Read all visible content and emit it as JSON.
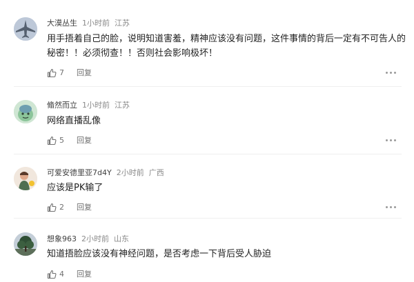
{
  "comments": [
    {
      "user": "大漠丛生",
      "time": "1小时前",
      "location": "江苏",
      "text": "用手捂着自己的脸，说明知道害羞，精神应该没有问题，这件事情的背后一定有不可告人的秘密！！必须彻查！！否则社会影响极坏！",
      "likes": "7",
      "reply_label": "回复",
      "avatar_icon": "fighter-jet-icon"
    },
    {
      "user": "翛然而立",
      "time": "1小时前",
      "location": "江苏",
      "text": "网络直播乱像",
      "likes": "5",
      "reply_label": "回复",
      "avatar_icon": "cartoon-creature-icon"
    },
    {
      "user": "可爱安德里亚7d4Y",
      "time": "2小时前",
      "location": "广西",
      "text": "应该是PK输了",
      "likes": "2",
      "reply_label": "回复",
      "avatar_icon": "person-illustration-icon"
    },
    {
      "user": "想象963",
      "time": "2小时前",
      "location": "山东",
      "text": "知道捂脸应该没有神经问题，是否考虑一下背后受人胁迫",
      "likes": "4",
      "reply_label": "回复",
      "avatar_icon": "tree-landscape-icon"
    }
  ],
  "colors": {
    "username": "#404040",
    "meta": "#8a8a8a",
    "body_text": "#222222",
    "action_text": "#707070"
  }
}
